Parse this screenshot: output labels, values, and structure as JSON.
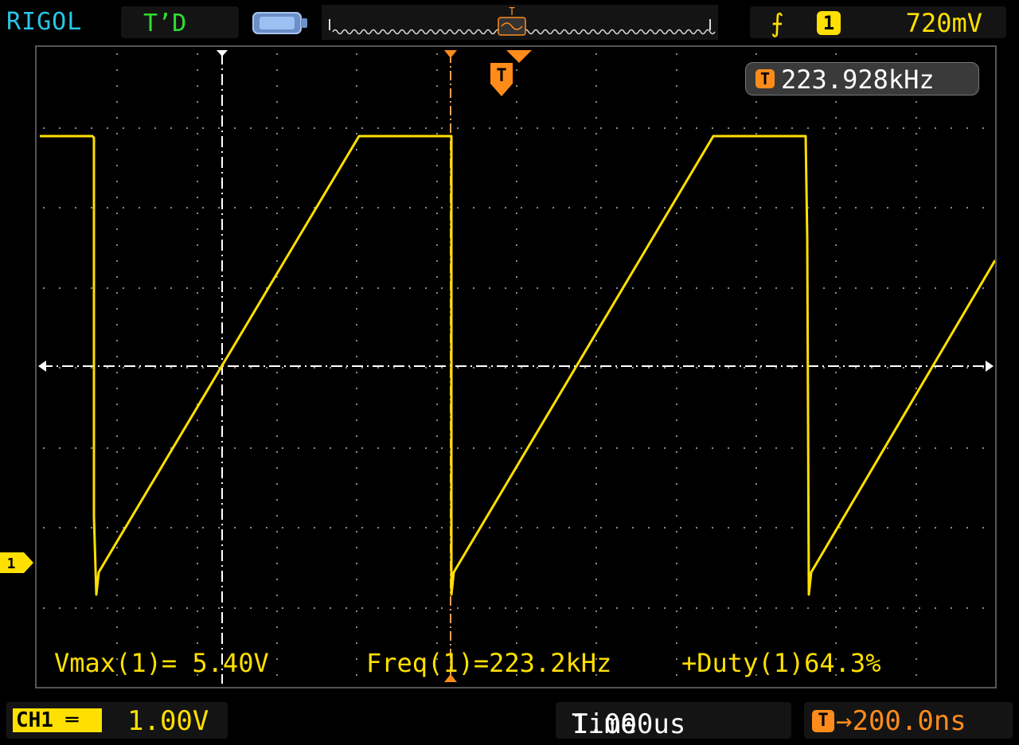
{
  "header": {
    "brand": "RIGOL",
    "trigger_status": "T’D",
    "trigger_edge_symbol": "⨍",
    "trigger_channel": "1",
    "trigger_level": "720mV"
  },
  "screen": {
    "frequency_counter": "223.928kHz",
    "trigger_marker": "T",
    "measurements": {
      "vmax": "Vmax(1)= 5.40V",
      "freq": "Freq(1)=223.2kHz",
      "duty": "+Duty(1)64.3%"
    }
  },
  "footer": {
    "channel_label": "CH1",
    "channel_scale": "1.00V",
    "time_label": "Time",
    "time_scale": "1.000us",
    "trigger_offset": "200.0ns"
  },
  "channel_marker": "1",
  "icons": {
    "battery": "battery-icon",
    "trigger_edge": "rising-edge-icon"
  },
  "colors": {
    "trace": "#ffe000",
    "brand": "#29c6e8",
    "status": "#2ee02e",
    "trigger": "#ff8c1a"
  }
}
